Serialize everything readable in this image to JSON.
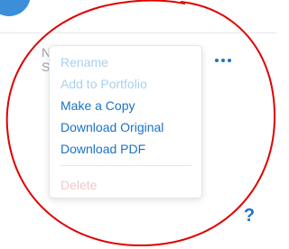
{
  "header": {
    "avatar": "avatar-circle"
  },
  "card": {
    "title_partial": "N",
    "subtitle_partial": "S",
    "more_icon": "ellipsis-icon"
  },
  "menu": {
    "items": [
      {
        "label": "Rename",
        "state": "disabled"
      },
      {
        "label": "Add to Portfolio",
        "state": "disabled"
      },
      {
        "label": "Make a Copy",
        "state": "enabled"
      },
      {
        "label": "Download Original",
        "state": "enabled"
      },
      {
        "label": "Download PDF",
        "state": "enabled"
      },
      {
        "label": "Delete",
        "state": "disabled"
      }
    ]
  },
  "help": {
    "label": "?"
  },
  "colors": {
    "accent": "#1a73c9",
    "disabled_item": "#a9d0ef",
    "disabled_delete": "#f5c7c7",
    "annotation": "#e00000"
  }
}
